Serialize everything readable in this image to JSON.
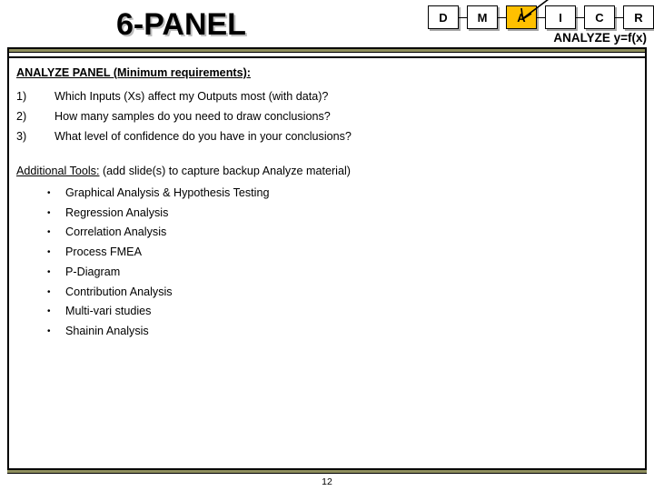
{
  "slide": {
    "title": "6-PANEL",
    "page_number": "12",
    "accent_color": "#ffc000",
    "rule_band_color": "#8f8f5e"
  },
  "roadmap": {
    "name": "dmaic-roadmap",
    "phase_label": "ANALYZE y=f(x)",
    "active_index": 2,
    "steps": [
      {
        "label": "D",
        "active": false
      },
      {
        "label": "M",
        "active": false
      },
      {
        "label": "A",
        "active": true
      },
      {
        "label": "I",
        "active": false
      },
      {
        "label": "C",
        "active": false
      },
      {
        "label": "R",
        "active": false
      }
    ]
  },
  "body": {
    "section_heading": "ANALYZE PANEL  (Minimum requirements):",
    "questions": [
      {
        "marker": "1)",
        "text": "Which Inputs (Xs) affect my Outputs most (with data)?"
      },
      {
        "marker": "2)",
        "text": "How many samples do you need to draw conclusions?"
      },
      {
        "marker": "3)",
        "text": "What level of confidence do you have in your conclusions?"
      }
    ],
    "tools_heading_underlined": "Additional Tools:",
    "tools_heading_rest": " (add slide(s) to capture backup Analyze material)",
    "bullet_glyph": "•",
    "tools": [
      "Graphical Analysis & Hypothesis Testing",
      "Regression Analysis",
      "Correlation Analysis",
      "Process FMEA",
      "P-Diagram",
      "Contribution Analysis",
      "Multi-vari studies",
      "Shainin Analysis"
    ]
  }
}
